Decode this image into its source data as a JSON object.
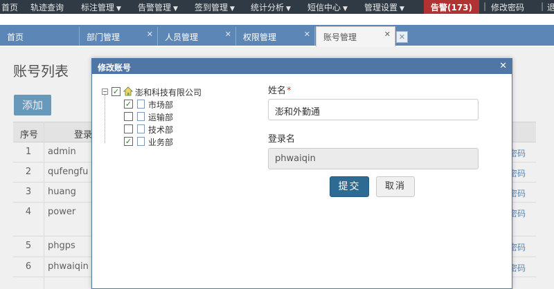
{
  "topnav": {
    "items": [
      {
        "label": "首页",
        "dropdown": false
      },
      {
        "label": "轨迹查询",
        "dropdown": false
      },
      {
        "label": "标注管理",
        "dropdown": true
      },
      {
        "label": "告警管理",
        "dropdown": true
      },
      {
        "label": "签到管理",
        "dropdown": true
      },
      {
        "label": "统计分析",
        "dropdown": true
      },
      {
        "label": "短信中心",
        "dropdown": true
      },
      {
        "label": "管理设置",
        "dropdown": true
      }
    ],
    "alarm": "告警(173)",
    "change_password": "修改密码",
    "logout": "退出"
  },
  "tabs": [
    {
      "label": "首页",
      "closable": false,
      "active": false
    },
    {
      "label": "部门管理",
      "closable": true,
      "active": false
    },
    {
      "label": "人员管理",
      "closable": true,
      "active": false
    },
    {
      "label": "权限管理",
      "closable": true,
      "active": false
    },
    {
      "label": "账号管理",
      "closable": true,
      "active": true
    }
  ],
  "page": {
    "title": "账号列表",
    "add_button": "添加",
    "columns": [
      "序号",
      "登录"
    ],
    "rows": [
      {
        "no": "1",
        "login": "admin",
        "action": "密码"
      },
      {
        "no": "2",
        "login": "qufengfu",
        "action": "密码"
      },
      {
        "no": "3",
        "login": "huang",
        "action": "密码"
      },
      {
        "no": "4",
        "login": "power",
        "action": "密码"
      },
      {
        "no": "5",
        "login": "phgps",
        "action": "密码"
      },
      {
        "no": "6",
        "login": "phwaiqin",
        "action": "密码"
      }
    ]
  },
  "modal": {
    "title": "修改账号",
    "tree": {
      "root": {
        "label": "澎和科技有限公司",
        "checked": true,
        "expanded": true
      },
      "children": [
        {
          "label": "市场部",
          "checked": true
        },
        {
          "label": "运输部",
          "checked": false
        },
        {
          "label": "技术部",
          "checked": false
        },
        {
          "label": "业务部",
          "checked": true
        }
      ]
    },
    "name_label": "姓名",
    "required_mark": "*",
    "name_value": "澎和外勤通",
    "login_label": "登录名",
    "login_value": "phwaiqin",
    "submit": "提交",
    "cancel": "取消"
  },
  "colors": {
    "topbar": "#2f3a44",
    "tab_strip": "#5b86b5",
    "modal_header": "#4f76a5",
    "submit": "#2d6b92",
    "alarm": "#b03232"
  }
}
